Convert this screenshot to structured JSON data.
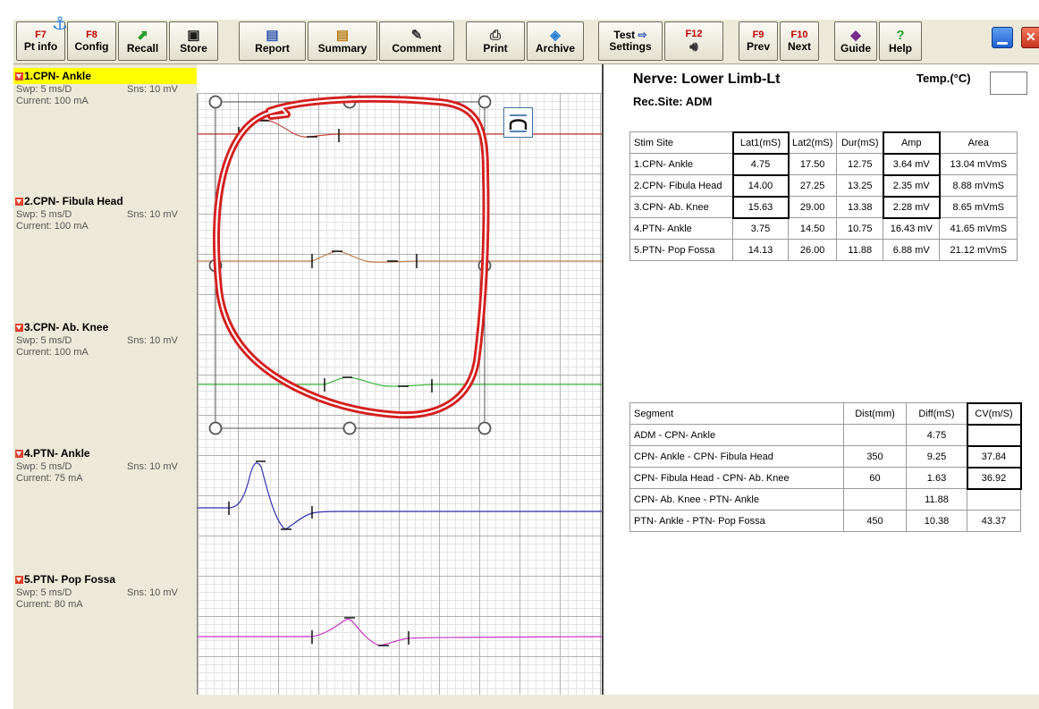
{
  "toolbar": {
    "buttons": [
      {
        "fkey": "F7",
        "label": "Pt info"
      },
      {
        "fkey": "F8",
        "label": "Config"
      },
      {
        "icon": "recall-icon",
        "label": "Recall"
      },
      {
        "icon": "floppy-icon",
        "label": "Store"
      },
      {
        "icon": "report-icon",
        "label": "Report"
      },
      {
        "icon": "summary-icon",
        "label": "Summary"
      },
      {
        "icon": "comment-icon",
        "label": "Comment"
      },
      {
        "icon": "printer-icon",
        "label": "Print"
      },
      {
        "icon": "archive-icon",
        "label": "Archive"
      },
      {
        "label": "Test",
        "label2": "Settings"
      },
      {
        "fkey": "F12",
        "icon": "speaker-icon"
      },
      {
        "fkey": "F9",
        "label": "Prev"
      },
      {
        "fkey": "F10",
        "label": "Next"
      },
      {
        "icon": "guide-book-icon",
        "label": "Guide"
      },
      {
        "icon": "help-icon",
        "label": "Help"
      }
    ],
    "help_glyph": "?"
  },
  "traces": [
    {
      "name": "1.CPN- Ankle",
      "sweep": "Swp: 5 ms/D",
      "sensitivity": "Sns: 10 mV",
      "current": "Current: 100 mA",
      "color": "#c8463c",
      "selected": true
    },
    {
      "name": "2.CPN- Fibula Head",
      "sweep": "Swp: 5 ms/D",
      "sensitivity": "Sns: 10 mV",
      "current": "Current: 100 mA",
      "color": "#c08050",
      "selected": false
    },
    {
      "name": "3.CPN- Ab. Knee",
      "sweep": "Swp: 5 ms/D",
      "sensitivity": "Sns: 10 mV",
      "current": "Current: 100 mA",
      "color": "#3cb43c",
      "selected": false
    },
    {
      "name": "4.PTN- Ankle",
      "sweep": "Swp: 5 ms/D",
      "sensitivity": "Sns: 10 mV",
      "current": "Current: 75 mA",
      "color": "#3232b4",
      "selected": false
    },
    {
      "name": "5.PTN- Pop Fossa",
      "sweep": "Swp: 5 ms/D",
      "sensitivity": "Sns: 10 mV",
      "current": "Current: 80 mA",
      "color": "#c832c8",
      "selected": false
    }
  ],
  "annotation": {
    "stroke_color": "#d42020"
  },
  "panel": {
    "nerve": "Nerve: Lower Limb-Lt",
    "rec_site": "Rec.Site: ADM",
    "temp_label": "Temp.(°C)",
    "temp_value": ""
  },
  "stim_table": {
    "headers": [
      "Stim Site",
      "Lat1(mS)",
      "Lat2(mS)",
      "Dur(mS)",
      "Amp",
      "Area"
    ],
    "rows": [
      [
        "1.CPN- Ankle",
        "4.75",
        "17.50",
        "12.75",
        "3.64 mV",
        "13.04 mVmS"
      ],
      [
        "2.CPN- Fibula Head",
        "14.00",
        "27.25",
        "13.25",
        "2.35 mV",
        "8.88 mVmS"
      ],
      [
        "3.CPN- Ab. Knee",
        "15.63",
        "29.00",
        "13.38",
        "2.28 mV",
        "8.65 mVmS"
      ],
      [
        "4.PTN- Ankle",
        "3.75",
        "14.50",
        "10.75",
        "16.43 mV",
        "41.65 mVmS"
      ],
      [
        "5.PTN- Pop Fossa",
        "14.13",
        "26.00",
        "11.88",
        "6.88 mV",
        "21.12 mVmS"
      ]
    ]
  },
  "segment_table": {
    "headers": [
      "Segment",
      "Dist(mm)",
      "Diff(mS)",
      "CV(m/S)"
    ],
    "rows": [
      [
        "ADM - CPN- Ankle",
        "",
        "4.75",
        ""
      ],
      [
        "CPN- Ankle - CPN- Fibula Head",
        "350",
        "9.25",
        "37.84"
      ],
      [
        "CPN- Fibula Head - CPN- Ab. Knee",
        "60",
        "1.63",
        "36.92"
      ],
      [
        "CPN- Ab. Knee - PTN- Ankle",
        "",
        "11.88",
        ""
      ],
      [
        "PTN- Ankle - PTN- Pop Fossa",
        "450",
        "10.38",
        "43.37"
      ]
    ]
  }
}
